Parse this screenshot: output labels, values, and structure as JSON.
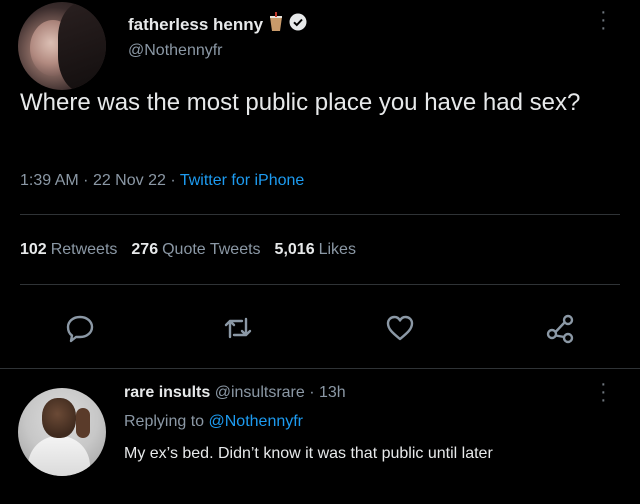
{
  "tweet": {
    "author_name": "fatherless henny",
    "author_handle": "@Nothennyfr",
    "text": "Where was the most public place you have had sex?",
    "time": "1:39 AM",
    "date": "22 Nov 22",
    "separator": "·",
    "source": "Twitter for iPhone",
    "stats": {
      "retweets_count": "102",
      "retweets_label": "Retweets",
      "quotes_count": "276",
      "quotes_label": "Quote Tweets",
      "likes_count": "5,016",
      "likes_label": "Likes"
    },
    "icons": {
      "verified": "verified-badge-icon",
      "emoji": "cup-emoji-icon",
      "more": "more-vertical-icon"
    },
    "actions": [
      "reply-icon",
      "retweet-icon",
      "like-icon",
      "share-icon"
    ]
  },
  "reply": {
    "author_name": "rare insults",
    "author_handle": "@insultsrare",
    "separator": "·",
    "age": "13h",
    "replying_label": "Replying to",
    "replying_to": "@Nothennyfr",
    "text": "My ex’s bed. Didn’t know it was that public until later"
  },
  "colors": {
    "background": "#000000",
    "text": "#e7e9ea",
    "secondary": "#8b98a5",
    "accent": "#1d9bf0",
    "divider": "#2f3336"
  }
}
